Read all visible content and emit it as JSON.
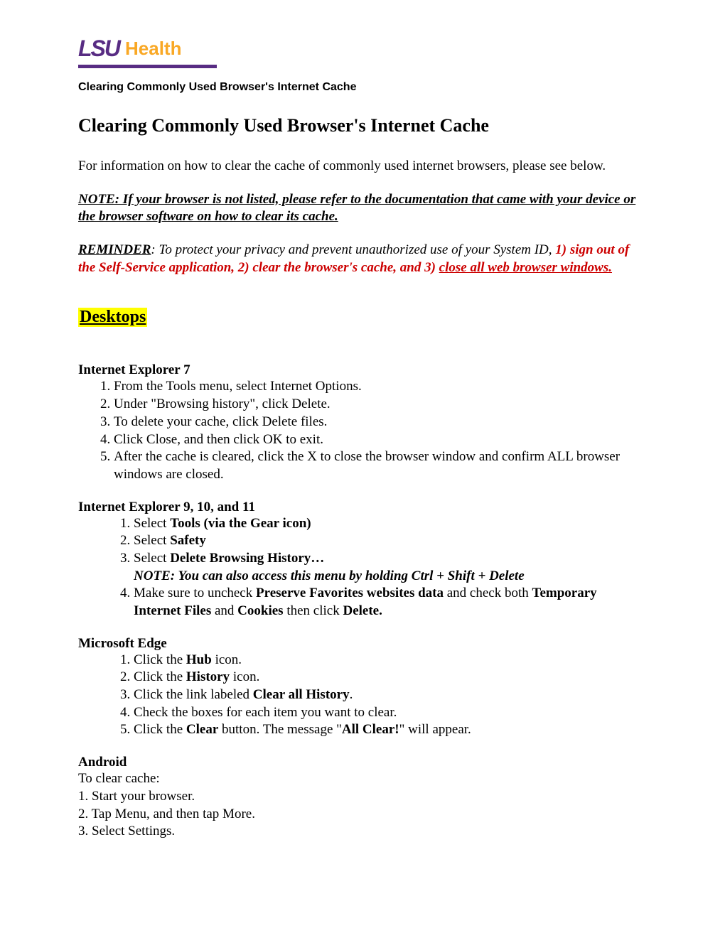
{
  "logo": {
    "lsu": "LSU",
    "health": "Health"
  },
  "doc_header": "Clearing Commonly Used Browser's Internet Cache",
  "main_title": "Clearing Commonly Used Browser's Internet Cache",
  "intro": "For information on how to clear the cache of commonly used internet browsers, please see below.",
  "note": "NOTE: If your browser is not listed, please refer to the documentation that came with your device or the browser software on how to clear its cache.",
  "reminder": {
    "label": "REMINDER",
    "colon": ": ",
    "text1": "  To protect your privacy and prevent unauthorized use of your System ID, ",
    "step1": "1) sign out of the Self-Service application, 2) clear the browser's cache, and 3) ",
    "step_last": "close all web browser windows."
  },
  "section_desktops": "Desktops",
  "ie7": {
    "title": "Internet Explorer 7",
    "steps": [
      "From the Tools menu, select Internet Options.",
      "Under \"Browsing history\", click Delete.",
      "To delete your cache, click Delete files.",
      "Click Close, and then click OK to exit.",
      "After the cache is cleared, click the X to close the browser window and confirm ALL browser windows are closed."
    ]
  },
  "ie9": {
    "title": "Internet Explorer 9, 10, and 11",
    "step1_pre": "Select ",
    "step1_b": "Tools (via the Gear icon)",
    "step2_pre": "Select ",
    "step2_b": "Safety",
    "step3_pre": "Select ",
    "step3_b": "Delete Browsing History…",
    "step3_note": "NOTE: You can also access this menu by holding Ctrl + Shift + Delete",
    "step4_a": "Make sure to uncheck ",
    "step4_b1": "Preserve Favorites websites data",
    "step4_c": " and check both ",
    "step4_b2": "Temporary Internet Files",
    "step4_d": " and ",
    "step4_b3": "Cookies",
    "step4_e": " then click ",
    "step4_b4": "Delete."
  },
  "edge": {
    "title": "Microsoft Edge",
    "s1a": "Click the ",
    "s1b": "Hub",
    "s1c": " icon.",
    "s2a": "Click the ",
    "s2b": "History",
    "s2c": " icon.",
    "s3a": "Click the link labeled ",
    "s3b": "Clear all History",
    "s3c": ".",
    "s4": "Check the boxes for each item you want to clear.",
    "s5a": "Click the ",
    "s5b": "Clear",
    "s5c": " button. The message \"",
    "s5d": "All Clear!",
    "s5e": "\" will appear."
  },
  "android": {
    "title": "Android",
    "pre": "To clear cache:",
    "s1": "1. Start your browser.",
    "s2": "2. Tap Menu, and then tap More.",
    "s3": "3. Select Settings."
  }
}
